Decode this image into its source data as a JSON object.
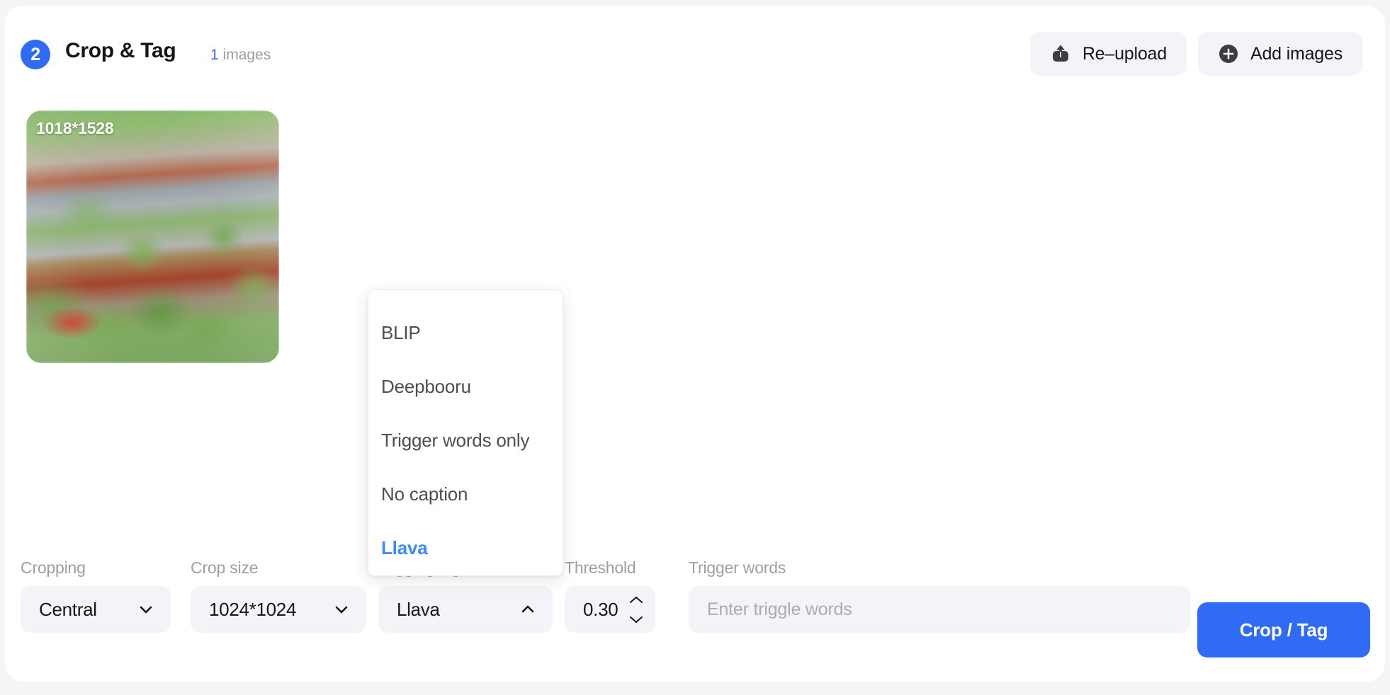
{
  "header": {
    "step_number": "2",
    "title": "Crop & Tag",
    "count_number": "1",
    "count_label": "images",
    "reupload_label": "Re–upload",
    "add_images_label": "Add images"
  },
  "thumbnail": {
    "dimensions": "1018*1528"
  },
  "controls": {
    "cropping": {
      "label": "Cropping",
      "value": "Central"
    },
    "crop_size": {
      "label": "Crop size",
      "value": "1024*1024"
    },
    "tagging_algorithm": {
      "label": "Tagging algorithm",
      "value": "Llava"
    },
    "threshold": {
      "label": "Threshold",
      "value": "0.30"
    },
    "trigger_words": {
      "label": "Trigger words",
      "value": "",
      "placeholder": "Enter triggle words"
    },
    "submit_label": "Crop / Tag"
  },
  "dropdown": {
    "options": [
      {
        "label": "BLIP",
        "selected": false
      },
      {
        "label": "Deepbooru",
        "selected": false
      },
      {
        "label": "Trigger words only",
        "selected": false
      },
      {
        "label": "No caption",
        "selected": false
      },
      {
        "label": "Llava",
        "selected": true
      }
    ]
  },
  "colors": {
    "accent": "#2f6bf5",
    "selected_option": "#3d8bfd",
    "field_bg": "#f3f4f7",
    "page_bg": "#f4f5f7",
    "label_gray": "#9aa0a8"
  }
}
